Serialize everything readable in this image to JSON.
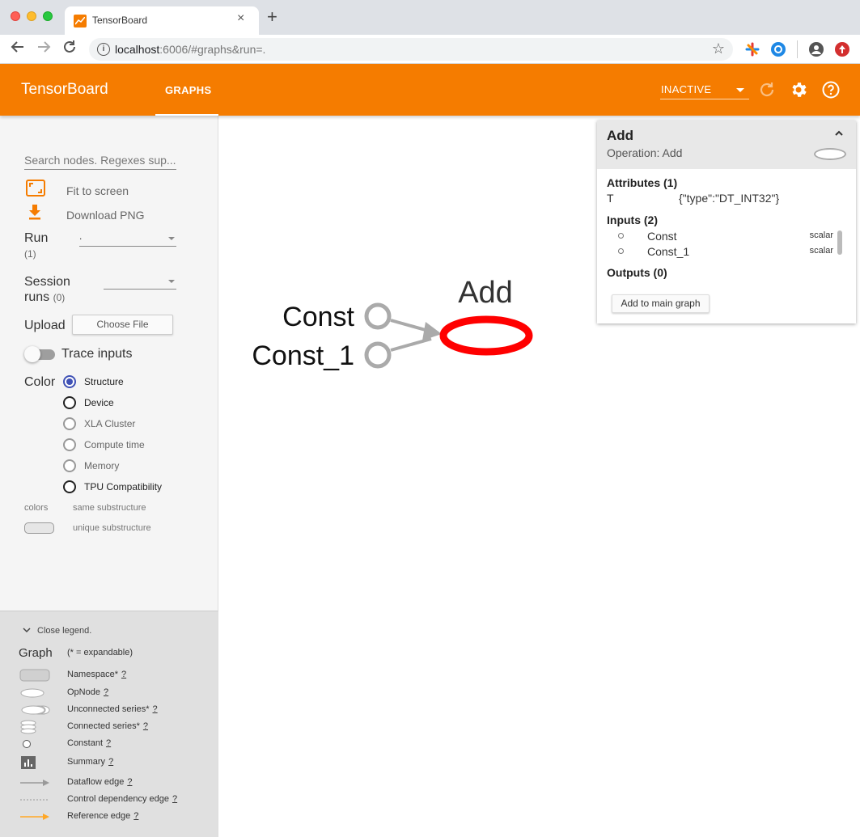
{
  "browser": {
    "tab_title": "TensorBoard",
    "tab_close": "×",
    "new_tab": "+",
    "url_host": "localhost",
    "url_rest": ":6006/#graphs&run=."
  },
  "header": {
    "title": "TensorBoard",
    "tab_graphs": "GRAPHS",
    "status_select": "INACTIVE"
  },
  "sidebar": {
    "search_placeholder": "Search nodes. Regexes sup...",
    "fit_to_screen": "Fit to screen",
    "download_png": "Download PNG",
    "run_label": "Run",
    "run_count": "(1)",
    "run_value": ".",
    "session_label_1": "Session",
    "session_label_2": "runs",
    "session_count": "(0)",
    "upload_label": "Upload",
    "choose_file": "Choose File",
    "trace_inputs": "Trace inputs",
    "color_label": "Color",
    "color_options": [
      "Structure",
      "Device",
      "XLA Cluster",
      "Compute time",
      "Memory",
      "TPU Compatibility"
    ],
    "colors_label": "colors",
    "same_substructure": "same substructure",
    "unique_substructure": "unique substructure"
  },
  "legend": {
    "close": "Close legend.",
    "graph": "Graph",
    "expandable": "(* = expandable)",
    "q": "?",
    "items": [
      "Namespace*",
      "OpNode",
      "Unconnected series*",
      "Connected series*",
      "Constant",
      "Summary",
      "Dataflow edge",
      "Control dependency edge",
      "Reference edge"
    ]
  },
  "graph": {
    "node_add": "Add",
    "node_const": "Const",
    "node_const1": "Const_1",
    "selected_color": "#ff0000",
    "const_color": "#aaaaaa"
  },
  "card": {
    "title": "Add",
    "subtitle": "Operation: Add",
    "attributes_header": "Attributes (1)",
    "attr_key": "T",
    "attr_value": "{\"type\":\"DT_INT32\"}",
    "inputs_header": "Inputs (2)",
    "inputs": [
      {
        "name": "Const",
        "type": "scalar"
      },
      {
        "name": "Const_1",
        "type": "scalar"
      }
    ],
    "outputs_header": "Outputs (0)",
    "add_button": "Add to main graph"
  },
  "colors": {
    "accent": "#f57c00",
    "radio_selected": "#3f51b5"
  }
}
